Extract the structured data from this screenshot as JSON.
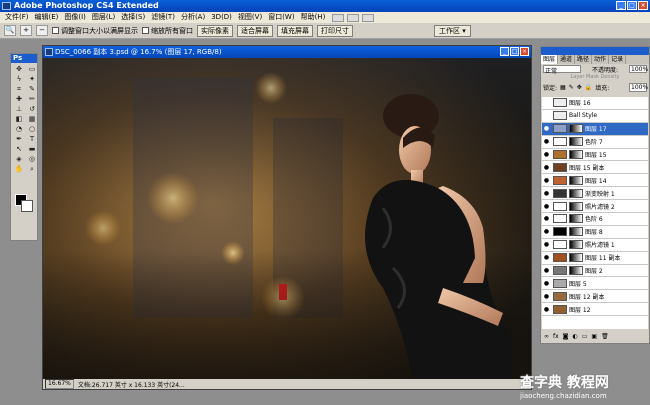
{
  "window": {
    "title": "Adobe Photoshop CS4 Extended"
  },
  "menu": [
    "文件(F)",
    "编辑(E)",
    "图像(I)",
    "图层(L)",
    "选择(S)",
    "滤镜(T)",
    "分析(A)",
    "3D(D)",
    "视图(V)",
    "窗口(W)",
    "帮助(H)"
  ],
  "options": {
    "chk1": "调整窗口大小以满屏显示",
    "chk2": "缩放所有窗口",
    "btn1": "实际像素",
    "btn2": "适合屏幕",
    "btn3": "填充屏幕",
    "btn4": "打印尺寸",
    "workspace": "工作区 ▾"
  },
  "toolbox": {
    "label": "Ps"
  },
  "document": {
    "title": "DSC_0066 副本 3.psd @ 16.7% (图层 17, RGB/8)",
    "zoom": "16.67%",
    "size": "文档:26.717 英寸 x 16.133 英寸(24...",
    "close": "×"
  },
  "layers_panel": {
    "tabs": [
      "图层",
      "通道",
      "路径",
      "动作",
      "记录"
    ],
    "blend_mode": "正常",
    "opacity_label": "不透明度:",
    "opacity": "100%",
    "lmd": "Layer Mask Density",
    "lock_label": "锁定:",
    "fill_label": "填充:",
    "fill": "100%",
    "layers": [
      {
        "name": "图层 16",
        "thumb": "#eee",
        "mask": false,
        "eye": false,
        "sel": false
      },
      {
        "name": "Ball Style",
        "thumb": "#eee",
        "mask": false,
        "eye": false,
        "sel": false
      },
      {
        "name": "图层 17",
        "thumb": "#8fa0c8",
        "mask": true,
        "eye": true,
        "sel": true
      },
      {
        "name": "色阶 7",
        "thumb": "#fff",
        "mask": true,
        "eye": true,
        "sel": false
      },
      {
        "name": "图层 15",
        "thumb": "#b07030",
        "mask": true,
        "eye": true,
        "sel": false
      },
      {
        "name": "图层 15 副本",
        "thumb": "#704020",
        "mask": false,
        "eye": true,
        "sel": false
      },
      {
        "name": "图层 14",
        "thumb": "#c06030",
        "mask": true,
        "eye": true,
        "sel": false
      },
      {
        "name": "渐变映射 1",
        "thumb": "#333",
        "mask": true,
        "eye": true,
        "sel": false
      },
      {
        "name": "照片滤镜 2",
        "thumb": "#fff",
        "mask": true,
        "eye": true,
        "sel": false
      },
      {
        "name": "色阶 6",
        "thumb": "#fff",
        "mask": true,
        "eye": true,
        "sel": false
      },
      {
        "name": "图层 8",
        "thumb": "#000",
        "mask": true,
        "eye": true,
        "sel": false
      },
      {
        "name": "照片滤镜 1",
        "thumb": "#fff",
        "mask": true,
        "eye": true,
        "sel": false
      },
      {
        "name": "图层 11 副本",
        "thumb": "#a05020",
        "mask": true,
        "eye": true,
        "sel": false
      },
      {
        "name": "图层 2",
        "thumb": "#777",
        "mask": true,
        "eye": true,
        "sel": false
      },
      {
        "name": "图层 5",
        "thumb": "#aaa",
        "mask": false,
        "eye": true,
        "sel": false
      },
      {
        "name": "图层 12 副本",
        "thumb": "#9a6a3a",
        "mask": false,
        "eye": true,
        "sel": false
      },
      {
        "name": "图层 12",
        "thumb": "#906030",
        "mask": false,
        "eye": true,
        "sel": false
      }
    ]
  },
  "watermark": {
    "brand": "查字典 教程网",
    "url": "jiaocheng.chazidian.com"
  },
  "colors": {
    "titlebar": "#0a5fd8",
    "selected": "#316ac5",
    "panel_bg": "#d4d0c8"
  }
}
